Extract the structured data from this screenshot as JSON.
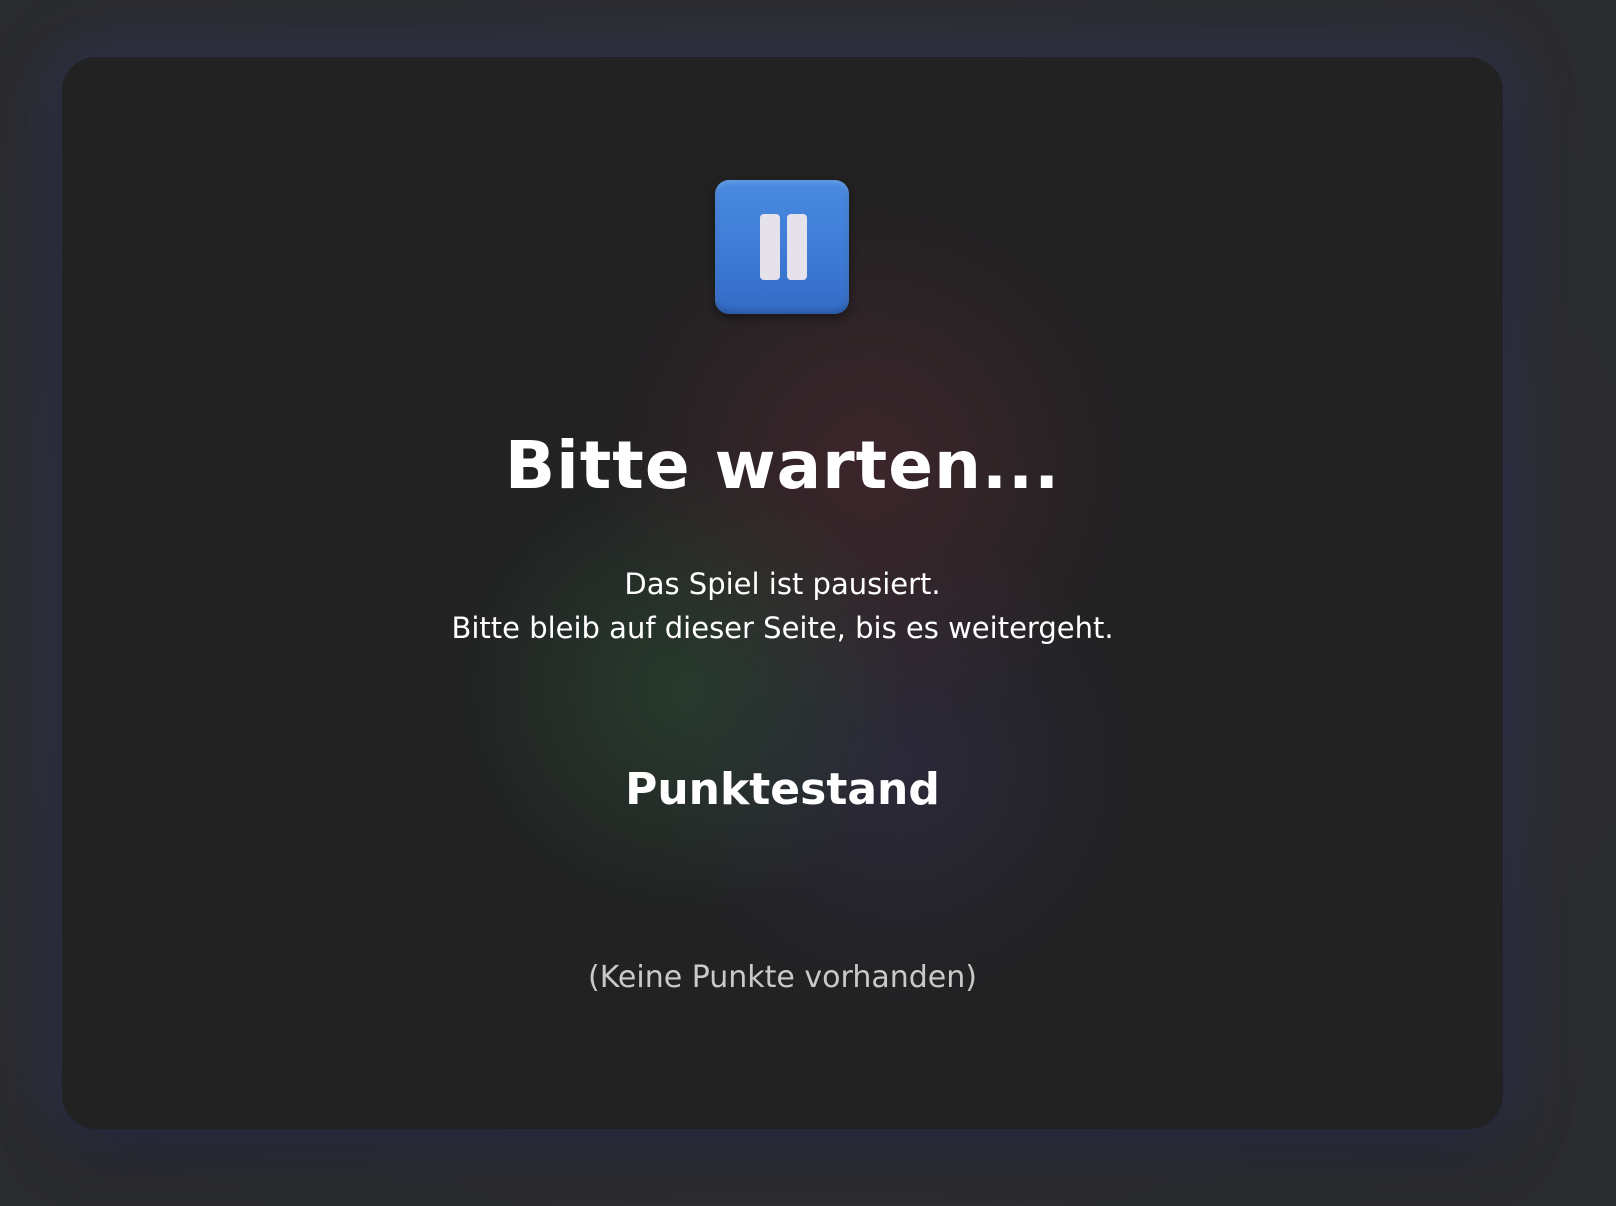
{
  "pause_screen": {
    "title": "Bitte warten...",
    "message_line1": "Das Spiel ist pausiert.",
    "message_line2": "Bitte bleib auf dieser Seite, bis es weitergeht.",
    "icon": "pause-icon",
    "icon_color": "#3f7fd8"
  },
  "scoreboard": {
    "heading": "Punktestand",
    "empty_text": "(Keine Punkte vorhanden)"
  },
  "colors": {
    "background": "#2c2d31",
    "card": "#222223",
    "text": "#ffffff",
    "muted_text": "#c9c9c9"
  }
}
